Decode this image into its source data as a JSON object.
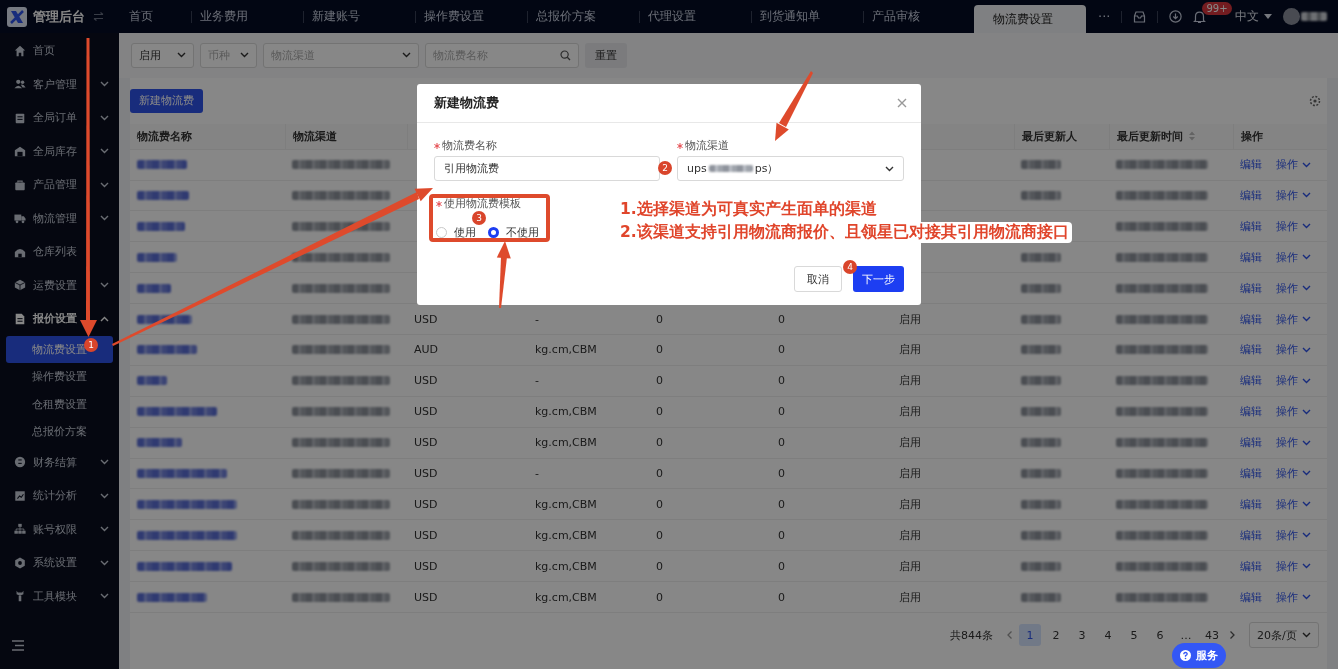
{
  "app": {
    "title": "管理后台"
  },
  "top_tabs": [
    {
      "label": "首页",
      "selected": false
    },
    {
      "label": "业务费用",
      "selected": false
    },
    {
      "label": "新建账号",
      "selected": false
    },
    {
      "label": "操作费设置",
      "selected": false
    },
    {
      "label": "总报价方案",
      "selected": false
    },
    {
      "label": "代理设置",
      "selected": false
    },
    {
      "label": "到货通知单",
      "selected": false
    },
    {
      "label": "产品审核",
      "selected": false
    },
    {
      "label": "物流费设置",
      "selected": true
    }
  ],
  "more_tabs": "···",
  "notifications": {
    "badge": "99+"
  },
  "language": "中文",
  "sidebar": {
    "items": [
      {
        "label": "首页",
        "kind": "link"
      },
      {
        "label": "客户管理",
        "kind": "group",
        "expanded": false
      },
      {
        "label": "全局订单",
        "kind": "group",
        "expanded": false
      },
      {
        "label": "全局库存",
        "kind": "group",
        "expanded": false
      },
      {
        "label": "产品管理",
        "kind": "group",
        "expanded": false
      },
      {
        "label": "物流管理",
        "kind": "group",
        "expanded": false
      },
      {
        "label": "仓库列表",
        "kind": "link"
      },
      {
        "label": "运费设置",
        "kind": "group",
        "expanded": false
      },
      {
        "label": "报价设置",
        "kind": "group",
        "expanded": true,
        "children": [
          {
            "label": "物流费设置",
            "selected": true
          },
          {
            "label": "操作费设置",
            "selected": false
          },
          {
            "label": "仓租费设置",
            "selected": false
          },
          {
            "label": "总报价方案",
            "selected": false
          }
        ]
      },
      {
        "label": "财务结算",
        "kind": "group",
        "expanded": false
      },
      {
        "label": "统计分析",
        "kind": "group",
        "expanded": false
      },
      {
        "label": "账号权限",
        "kind": "group",
        "expanded": false
      },
      {
        "label": "系统设置",
        "kind": "group",
        "expanded": false
      },
      {
        "label": "工具模块",
        "kind": "group",
        "expanded": false
      }
    ]
  },
  "filters": {
    "status": {
      "value": "启用"
    },
    "currency": {
      "placeholder": "币种"
    },
    "channel": {
      "placeholder": "物流渠道"
    },
    "name_search": {
      "placeholder": "物流费名称"
    },
    "reset_button": "重置"
  },
  "new_button": "新建物流费",
  "table": {
    "columns": [
      {
        "label": "物流费名称",
        "sortable": false
      },
      {
        "label": "物流渠道",
        "sortable": false
      },
      {
        "label": "最后更新人",
        "sortable": false
      },
      {
        "label": "最后更新时间",
        "sortable": true
      },
      {
        "label": "操作",
        "sortable": false
      }
    ],
    "rows": [
      {
        "edit": "编辑",
        "action": "操作"
      },
      {
        "edit": "编辑",
        "action": "操作"
      },
      {
        "edit": "编辑",
        "action": "操作"
      },
      {
        "edit": "编辑",
        "action": "操作"
      },
      {
        "edit": "编辑",
        "action": "操作"
      },
      {
        "currency": "USD",
        "unit": "-",
        "value_1": "0",
        "value_2": "0",
        "status": "启用",
        "edit": "编辑",
        "action": "操作"
      },
      {
        "currency": "AUD",
        "unit": "kg.cm,CBM",
        "value_1": "0",
        "value_2": "0",
        "status": "启用",
        "edit": "编辑",
        "action": "操作"
      },
      {
        "currency": "USD",
        "unit": "-",
        "value_1": "0",
        "value_2": "0",
        "status": "启用",
        "edit": "编辑",
        "action": "操作"
      },
      {
        "currency": "USD",
        "unit": "kg.cm,CBM",
        "value_1": "0",
        "value_2": "0",
        "status": "启用",
        "edit": "编辑",
        "action": "操作"
      },
      {
        "currency": "USD",
        "unit": "kg.cm,CBM",
        "value_1": "0",
        "value_2": "0",
        "status": "启用",
        "edit": "编辑",
        "action": "操作"
      },
      {
        "currency": "USD",
        "unit": "-",
        "value_1": "0",
        "value_2": "0",
        "status": "启用",
        "edit": "编辑",
        "action": "操作"
      },
      {
        "currency": "USD",
        "unit": "kg.cm,CBM",
        "value_1": "0",
        "value_2": "0",
        "status": "启用",
        "edit": "编辑",
        "action": "操作"
      },
      {
        "currency": "USD",
        "unit": "kg.cm,CBM",
        "value_1": "0",
        "value_2": "0",
        "status": "启用",
        "edit": "编辑",
        "action": "操作"
      },
      {
        "currency": "USD",
        "unit": "kg.cm,CBM",
        "value_1": "0",
        "value_2": "0",
        "status": "启用",
        "edit": "编辑",
        "action": "操作"
      },
      {
        "currency": "USD",
        "unit": "kg.cm,CBM",
        "value_1": "0",
        "value_2": "0",
        "status": "启用",
        "edit": "编辑",
        "action": "操作"
      }
    ]
  },
  "pagination": {
    "total": "共844条",
    "pages": [
      {
        "label": "1",
        "selected": true
      },
      {
        "label": "2",
        "selected": false
      },
      {
        "label": "3",
        "selected": false
      },
      {
        "label": "4",
        "selected": false
      },
      {
        "label": "5",
        "selected": false
      },
      {
        "label": "6",
        "selected": false
      },
      {
        "label": "…",
        "selected": false
      },
      {
        "label": "43",
        "selected": false
      }
    ],
    "page_size": "20条/页"
  },
  "modal": {
    "title": "新建物流费",
    "fields": [
      {
        "label": "物流费名称",
        "required": true,
        "kind": "input",
        "value": "引用物流费"
      },
      {
        "label": "物流渠道",
        "required": true,
        "kind": "select",
        "value_start": "ups",
        "value_end": "ps）"
      }
    ],
    "radio_group": {
      "label": "使用物流费模板",
      "required": true,
      "options": [
        {
          "label": "使用",
          "selected": false
        },
        {
          "label": "不使用",
          "selected": true
        }
      ]
    },
    "buttons": [
      {
        "label": "取消",
        "kind": "default"
      },
      {
        "label": "下一步",
        "kind": "primary"
      }
    ]
  },
  "annotations": {
    "notes": [
      "1.选择渠道为可真实产生面单的渠道",
      "2.该渠道支持引用物流商报价、且领星已对接其引用物流商接口"
    ],
    "steps": [
      "1",
      "2",
      "3",
      "4"
    ]
  },
  "service_button": "服务"
}
